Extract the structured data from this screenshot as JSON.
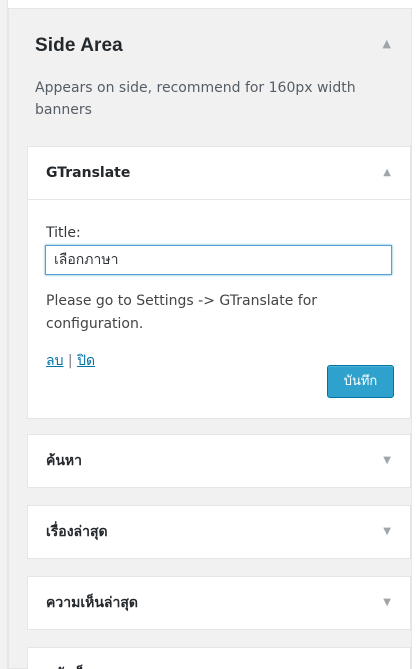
{
  "sidebar": {
    "title": "Side Area",
    "description": "Appears on side, recommend for 160px width banners",
    "toggle_icon": "arrow-up-icon"
  },
  "widgets": [
    {
      "title": "GTranslate",
      "state": "open",
      "form": {
        "title_label": "Title:",
        "title_value": "เลือกภาษา",
        "info": "Please go to Settings -> GTranslate for configuration.",
        "delete_link": "ลบ",
        "separator": "|",
        "close_link": "ปิด",
        "save_label": "บันทึก"
      }
    },
    {
      "title": "ค้นหา",
      "state": "closed"
    },
    {
      "title": "เรื่องล่าสุด",
      "state": "closed"
    },
    {
      "title": "ความเห็นล่าสุด",
      "state": "closed"
    },
    {
      "title": "คลังเก็บ",
      "state": "closed"
    }
  ],
  "icons": {
    "arrow_up": "▲",
    "arrow_down": "▼"
  },
  "colors": {
    "accent": "#2ea2cc",
    "link": "#0073aa",
    "focus_border": "#5b9dd9"
  }
}
